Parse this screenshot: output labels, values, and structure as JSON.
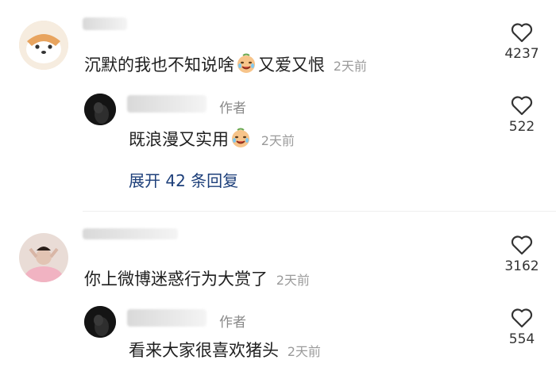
{
  "comments": [
    {
      "text": "沉默的我也不知说啥",
      "text_after_emoji": "又爱又恨",
      "time": "2天前",
      "likes": "4237",
      "reply": {
        "author_tag": "作者",
        "text": "既浪漫又实用",
        "time": "2天前",
        "likes": "522"
      },
      "expand_label": "展开 42 条回复"
    },
    {
      "text": "你上微博迷惑行为大赏了",
      "time": "2天前",
      "likes": "3162",
      "reply": {
        "author_tag": "作者",
        "text": "看来大家很喜欢猪头",
        "time": "2天前",
        "likes": "554"
      }
    }
  ],
  "colors": {
    "expand_link": "#1d3f7a",
    "time": "#9b9b9b",
    "author_tag": "#8a8a8a"
  },
  "icons": {
    "like": "heart-outline-icon",
    "emoji": "crying-laugh-emoji-icon"
  }
}
